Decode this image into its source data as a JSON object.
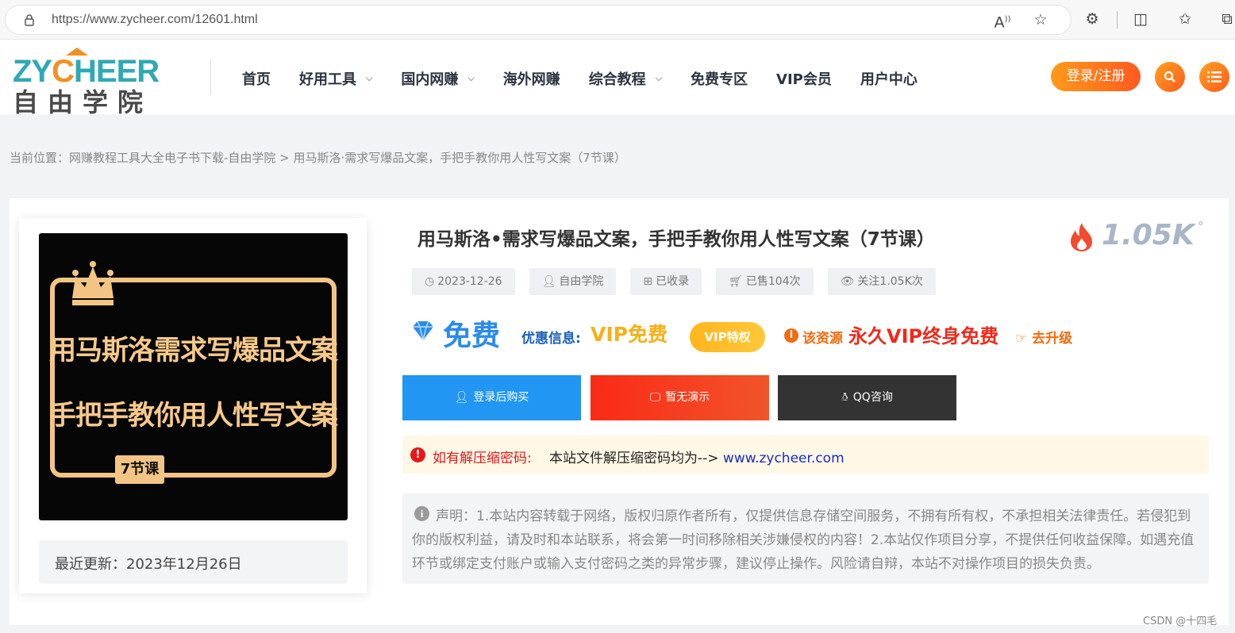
{
  "browser": {
    "url": "https://www.zycheer.com/12601.html"
  },
  "logo": {
    "en_prefix": "ZY",
    "en_o": "C",
    "en_suffix": "HEER",
    "cn": "自由学院"
  },
  "nav": {
    "items": [
      {
        "label": "首页"
      },
      {
        "label": "好用工具"
      },
      {
        "label": "国内网赚"
      },
      {
        "label": "海外网赚"
      },
      {
        "label": "综合教程"
      },
      {
        "label": "免费专区"
      },
      {
        "label": "VIP会员"
      },
      {
        "label": "用户中心"
      }
    ],
    "login_label": "登录/注册"
  },
  "breadcrumb": "当前位置：网赚教程工具大全电子书下载-自由学院 > 用马斯洛·需求写爆品文案，手把手教你用人性写文案（7节课）",
  "cover": {
    "line1": "用马斯洛需求写爆品文案",
    "line2": "手把手教你用人性写文案",
    "badge": "7节课"
  },
  "update_text": "最近更新：2023年12月26日",
  "post": {
    "title": "用马斯洛•需求写爆品文案，手把手教你用人性写文案（7节课）",
    "views": "1.05K",
    "views_deg": "°",
    "meta": {
      "date": "2023-12-26",
      "author": "自由学院",
      "status": "已收录",
      "sold": "已售104次",
      "follow": "关注1.05K次"
    }
  },
  "price": {
    "free": "免费",
    "promo_label": "优惠信息:",
    "promo_vip": "VIP免费",
    "vip_pill": "VIP特权",
    "res_label": "该资源",
    "res_free": "永久VIP终身免费",
    "upgrade": "去升级"
  },
  "actions": {
    "buy": "登录后购买",
    "demo": "暂无演示",
    "qq": "QQ咨询"
  },
  "notice": {
    "label": "如有解压缩密码:",
    "text": "本站文件解压缩密码均为-->",
    "link": "www.zycheer.com"
  },
  "disclaimer": "声明：1.本站内容转载于网络，版权归原作者所有，仅提供信息存储空间服务，不拥有所有权，不承担相关法律责任。若侵犯到你的版权利益，请及时和本站联系，将会第一时间移除相关涉嫌侵权的内容！2.本站仅作项目分享，不提供任何收益保障。如遇充值环节或绑定支付账户或输入支付密码之类的异常步骤，建议停止操作。风险请自辩，本站不对操作项目的损失负责。",
  "watermark": "CSDN @十四毛",
  "colors": {
    "accent_blue": "#2a8bef",
    "accent_orange": "#f46a0d",
    "accent_red": "#ee2a1b",
    "buy_button": "#2196f3",
    "demo_button": "#f43a1e",
    "qq_button": "#333333"
  }
}
